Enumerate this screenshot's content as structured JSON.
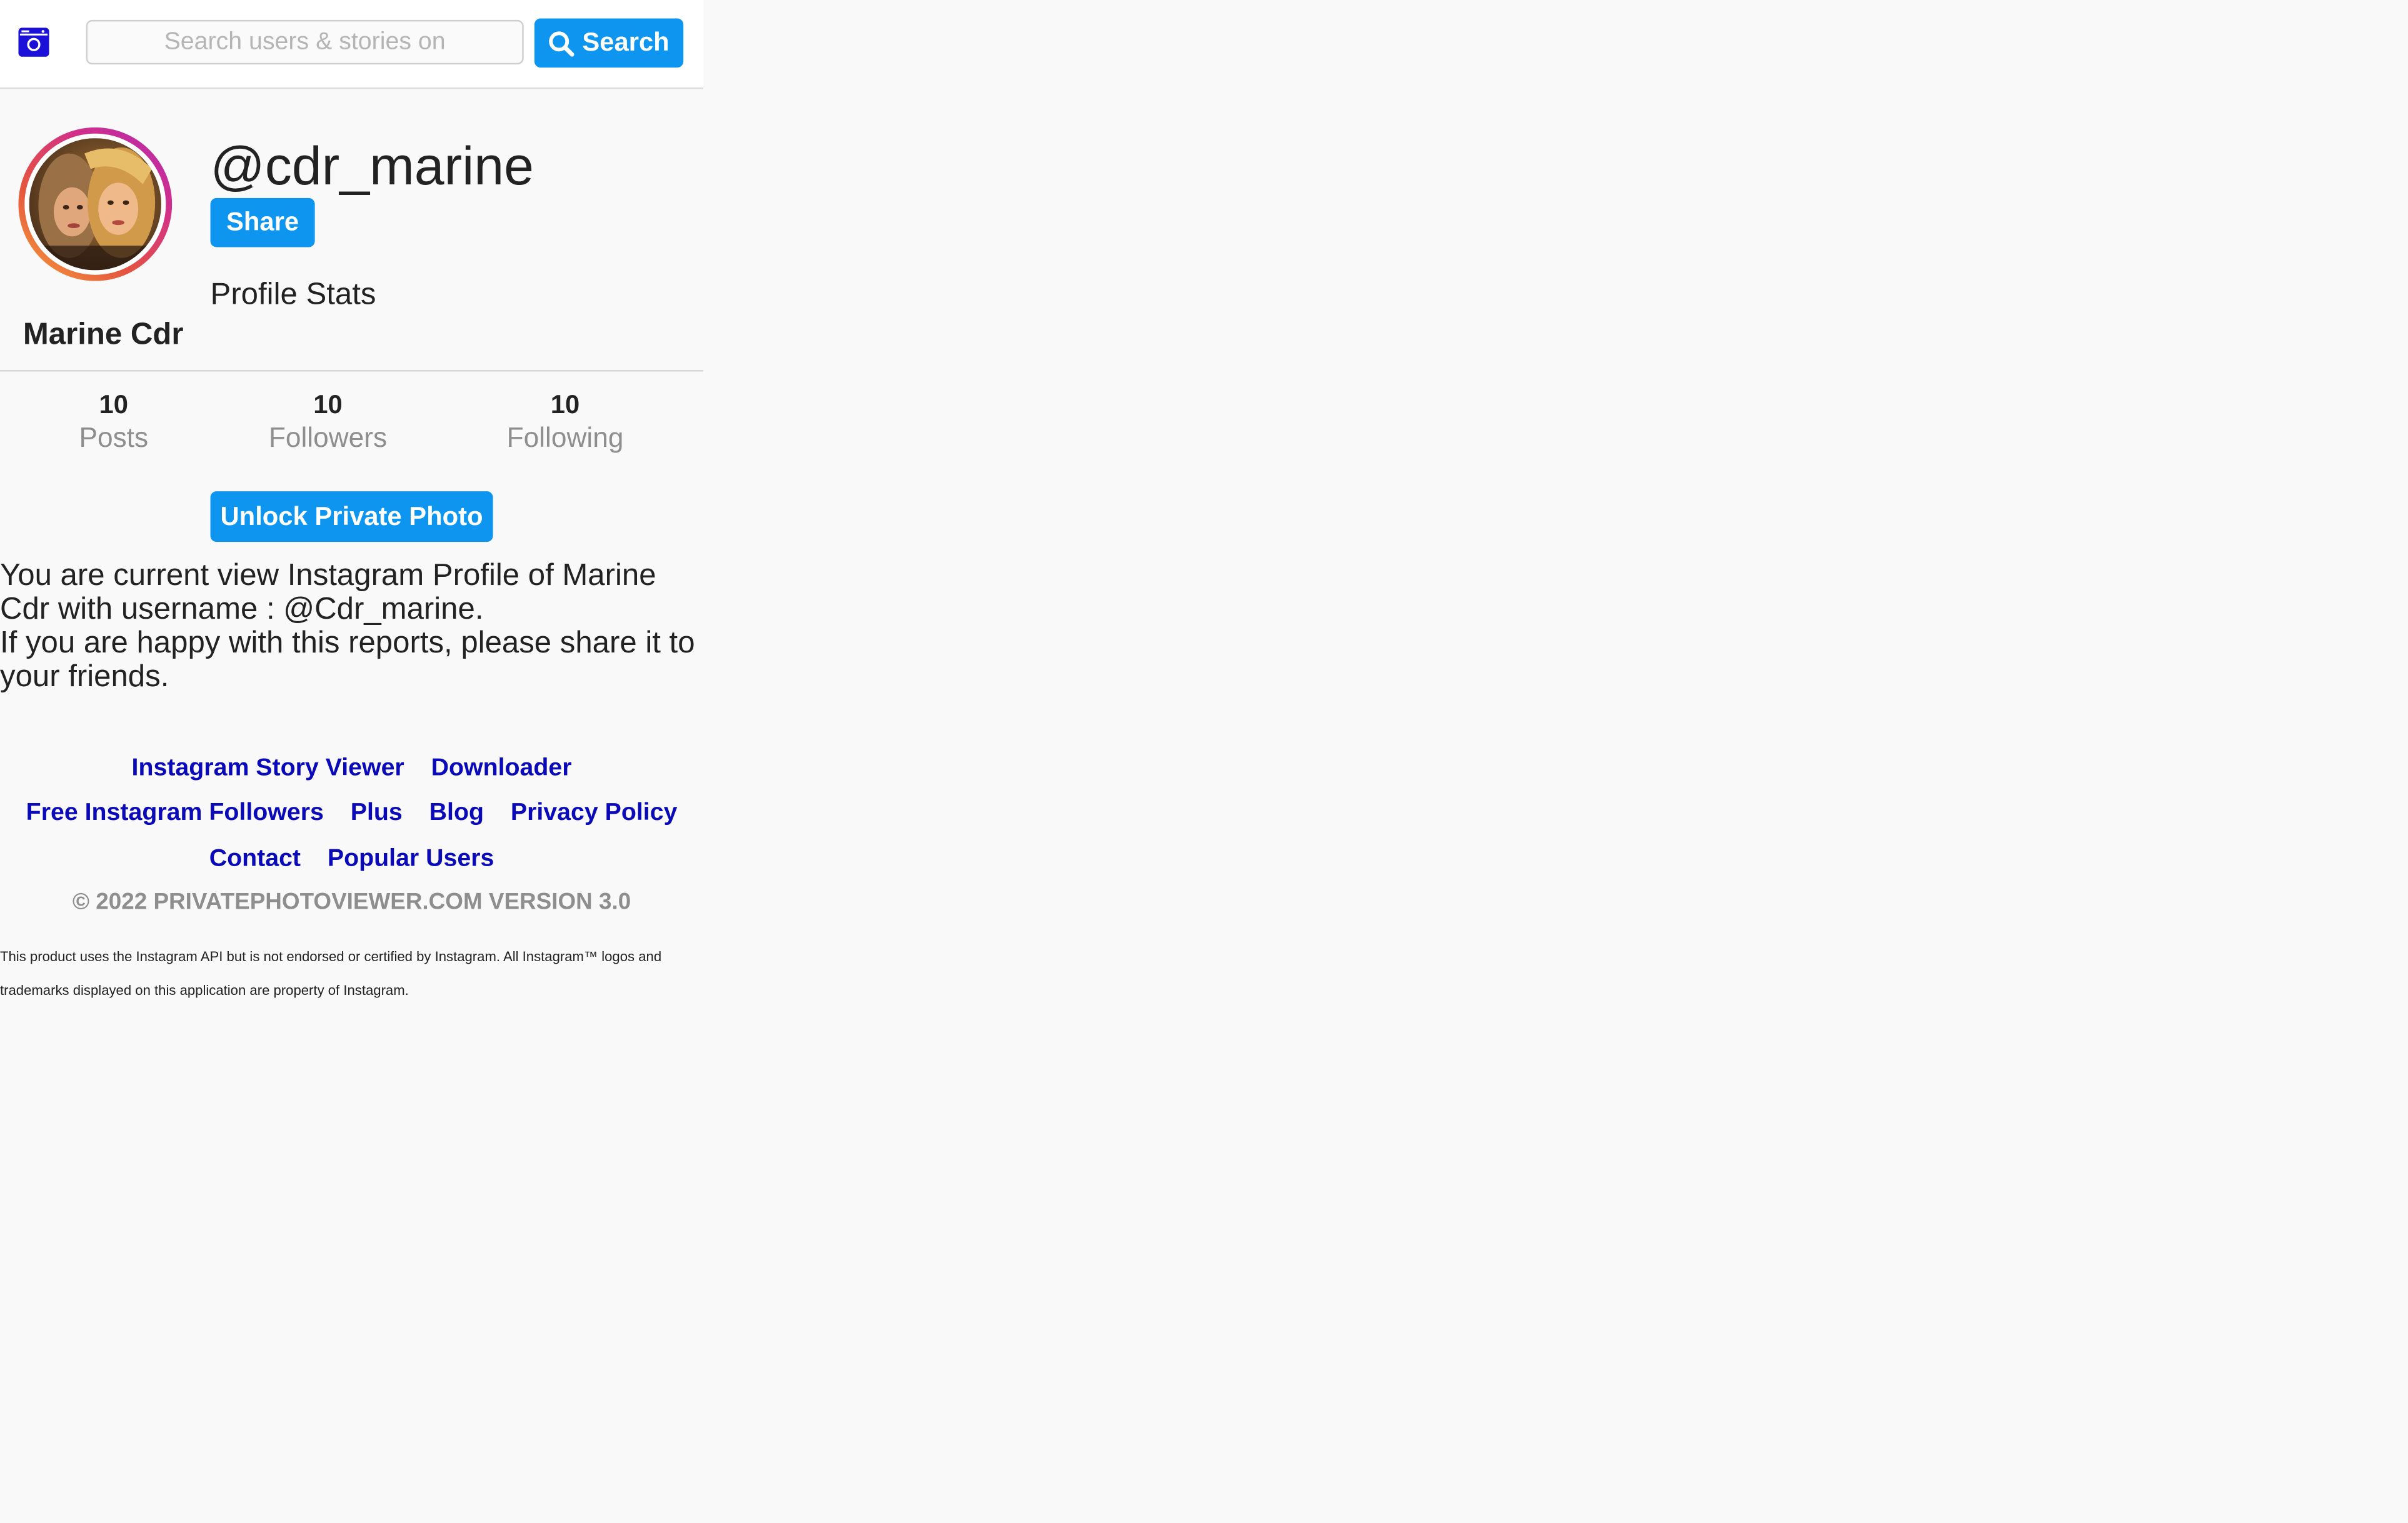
{
  "header": {
    "logo_icon": "instagram-camera-icon",
    "search": {
      "placeholder": "Search users & stories on",
      "value": ""
    },
    "search_button": {
      "icon": "search-icon",
      "label": "Search"
    }
  },
  "profile": {
    "avatar": "profile-photo",
    "username": "@cdr_marine",
    "full_name": "Marine Cdr",
    "share_label": "Share",
    "stats_heading": "Profile Stats"
  },
  "stats": {
    "posts": {
      "count": "10",
      "label": "Posts"
    },
    "followers": {
      "count": "10",
      "label": "Followers"
    },
    "following": {
      "count": "10",
      "label": "Following"
    }
  },
  "unlock_label": "Unlock Private Photo",
  "description": {
    "line1": "You are current view Instagram Profile of Marine Cdr with username : @Cdr_marine.",
    "line2": "If you are happy with this reports, please share it to your friends."
  },
  "footer": {
    "links": {
      "story_viewer": "Instagram Story Viewer",
      "downloader": "Downloader",
      "free_followers": "Free Instagram Followers",
      "plus": "Plus",
      "blog": "Blog",
      "privacy": "Privacy Policy",
      "contact": "Contact",
      "popular_users": "Popular Users"
    },
    "copyright": "© 2022 PRIVATEPHOTOVIEWER.COM VERSION 3.0",
    "disclaimer": "This product uses the Instagram API but is not endorsed or certified by Instagram. All Instagram™ logos and trademarks displayed on this application are property of Instagram."
  },
  "colors": {
    "accent": "#0d95f0",
    "link": "#0a0ab8",
    "muted": "#8e8e8e",
    "background": "#f9f9f9"
  }
}
